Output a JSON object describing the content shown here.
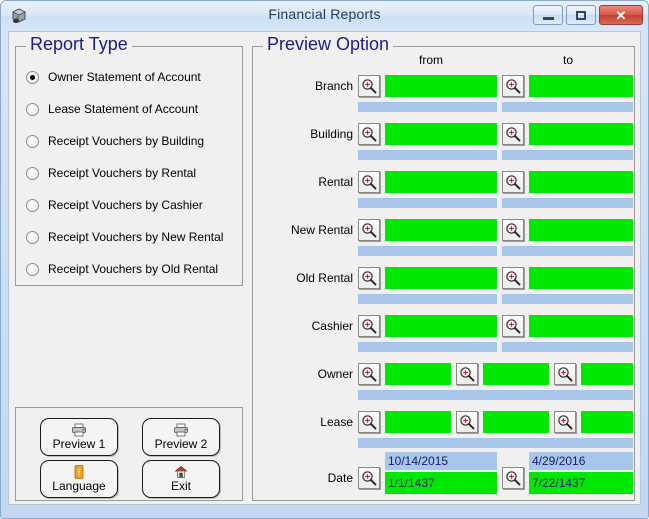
{
  "window": {
    "title": "Financial Reports",
    "app_icon": "application-icon",
    "controls": {
      "minimize": "minimize-button",
      "maximize": "maximize-button",
      "close": "close-button"
    }
  },
  "colors": {
    "field_green": "#00e800",
    "field_blue": "#a8c6ea",
    "group_title": "#1b1b8f",
    "titlebar_text": "#1b3a5c",
    "close_button": "#c23f30"
  },
  "report_type": {
    "title": "Report Type",
    "selected_index": 0,
    "options": [
      {
        "label": "Owner Statement of Account",
        "checked": true
      },
      {
        "label": "Lease Statement of Account",
        "checked": false
      },
      {
        "label": "Receipt Vouchers by Building",
        "checked": false
      },
      {
        "label": "Receipt Vouchers by Rental",
        "checked": false
      },
      {
        "label": "Receipt Vouchers by Cashier",
        "checked": false
      },
      {
        "label": "Receipt Vouchers by New Rental",
        "checked": false
      },
      {
        "label": "Receipt Vouchers by Old Rental",
        "checked": false
      }
    ]
  },
  "preview_option": {
    "title": "Preview Option",
    "column_headers": {
      "from": "from",
      "to": "to"
    },
    "lookup_icon": "magnifier-plus-icon",
    "rows": [
      {
        "label": "Branch",
        "type": "two-column",
        "from": {
          "value": "",
          "placeholder": ""
        },
        "to": {
          "value": "",
          "placeholder": ""
        },
        "from_sub": {
          "value": "",
          "placeholder": ""
        },
        "to_sub": {
          "value": "",
          "placeholder": ""
        }
      },
      {
        "label": "Building",
        "type": "two-column",
        "from": {
          "value": "",
          "placeholder": ""
        },
        "to": {
          "value": "",
          "placeholder": ""
        },
        "from_sub": {
          "value": "",
          "placeholder": ""
        },
        "to_sub": {
          "value": "",
          "placeholder": ""
        }
      },
      {
        "label": "Rental",
        "type": "two-column",
        "from": {
          "value": "",
          "placeholder": ""
        },
        "to": {
          "value": "",
          "placeholder": ""
        },
        "from_sub": {
          "value": "",
          "placeholder": ""
        },
        "to_sub": {
          "value": "",
          "placeholder": ""
        }
      },
      {
        "label": "New Rental",
        "type": "two-column",
        "from": {
          "value": "",
          "placeholder": ""
        },
        "to": {
          "value": "",
          "placeholder": ""
        },
        "from_sub": {
          "value": "",
          "placeholder": ""
        },
        "to_sub": {
          "value": "",
          "placeholder": ""
        }
      },
      {
        "label": "Old Rental",
        "type": "two-column",
        "from": {
          "value": "",
          "placeholder": ""
        },
        "to": {
          "value": "",
          "placeholder": ""
        },
        "from_sub": {
          "value": "",
          "placeholder": ""
        },
        "to_sub": {
          "value": "",
          "placeholder": ""
        }
      },
      {
        "label": "Cashier",
        "type": "two-column",
        "from": {
          "value": "",
          "placeholder": ""
        },
        "to": {
          "value": "",
          "placeholder": ""
        },
        "from_sub": {
          "value": "",
          "placeholder": ""
        },
        "to_sub": {
          "value": "",
          "placeholder": ""
        }
      },
      {
        "label": "Owner",
        "type": "three-column",
        "f1": {
          "value": ""
        },
        "f2": {
          "value": ""
        },
        "f3": {
          "value": ""
        },
        "sub": {
          "value": ""
        }
      },
      {
        "label": "Lease",
        "type": "three-column",
        "f1": {
          "value": ""
        },
        "f2": {
          "value": ""
        },
        "f3": {
          "value": ""
        },
        "sub": {
          "value": ""
        }
      },
      {
        "label": "Date",
        "type": "date",
        "from_gregorian": {
          "value": "10/14/2015"
        },
        "from_hijri": {
          "value": "1/1/1437"
        },
        "to_gregorian": {
          "value": "4/29/2016"
        },
        "to_hijri": {
          "value": "7/22/1437"
        }
      }
    ]
  },
  "actions": {
    "buttons": [
      {
        "label": "Preview 1",
        "icon": "printer-icon"
      },
      {
        "label": "Preview 2",
        "icon": "printer-icon"
      },
      {
        "label": "Language",
        "icon": "language-icon"
      },
      {
        "label": "Exit",
        "icon": "exit-door-icon"
      }
    ]
  }
}
